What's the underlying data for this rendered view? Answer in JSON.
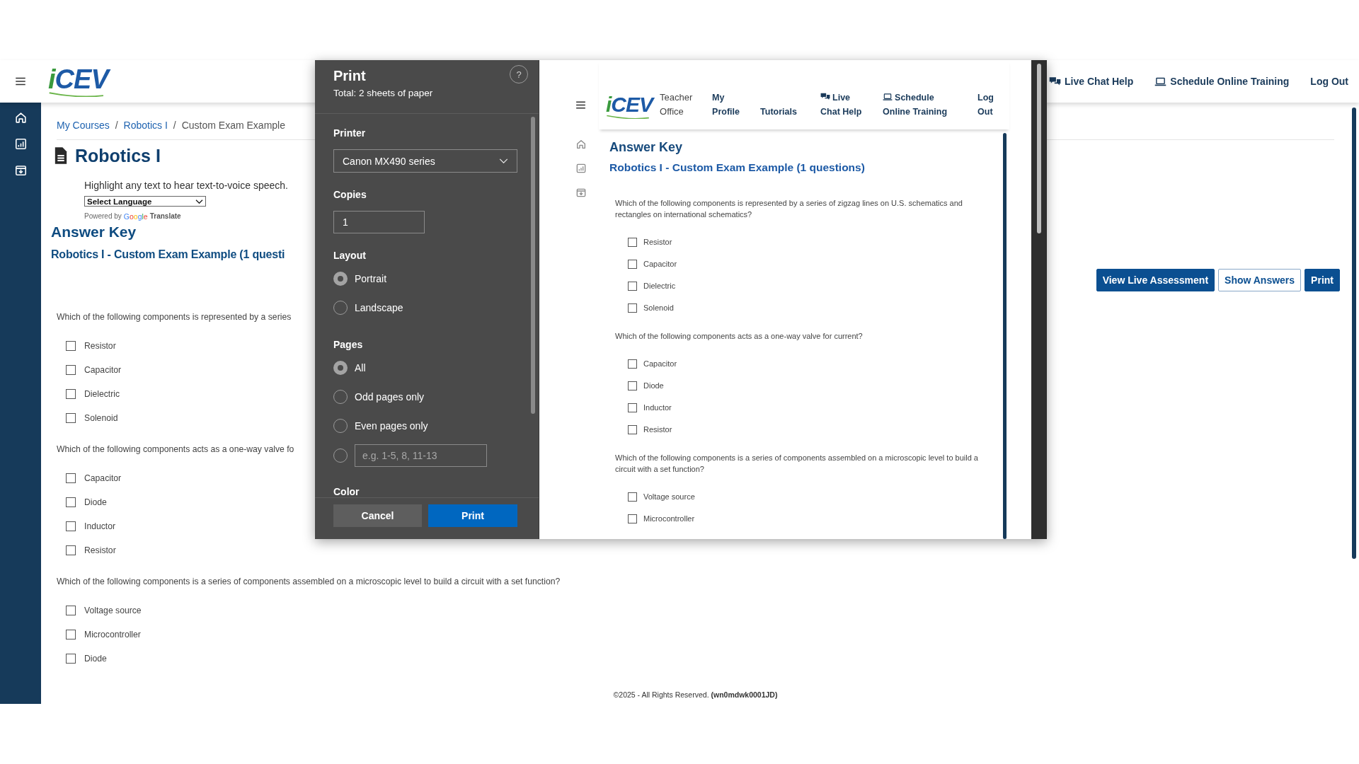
{
  "header": {
    "logo": "iCEV",
    "nav": [
      {
        "kind": "chat",
        "label": "Live Chat Help"
      },
      {
        "kind": "laptop",
        "label": "Schedule Online Training"
      },
      {
        "kind": "plain",
        "label": "Log Out"
      }
    ]
  },
  "breadcrumb": [
    {
      "kind": "link",
      "label": "My Courses"
    },
    {
      "kind": "separator",
      "label": "/"
    },
    {
      "kind": "link",
      "label": "Robotics I"
    },
    {
      "kind": "separator",
      "label": "/"
    },
    {
      "kind": "current",
      "label": "Custom Exam Example"
    }
  ],
  "page_title": "Robotics I",
  "speech_hint": "Highlight any text to hear text-to-voice speech.",
  "language_select": {
    "value": "Select Language"
  },
  "powered_by": {
    "prefix": "Powered by",
    "brand": "Google",
    "suffix": "Translate"
  },
  "answer_key": "Answer Key",
  "exam_title": "Robotics I - Custom Exam Example (1 questi",
  "actions": [
    {
      "label": "View Live Assessment",
      "primary": true
    },
    {
      "label": "Show Answers",
      "primary": false
    },
    {
      "label": "Print",
      "primary": true
    }
  ],
  "questions": [
    {
      "text": "Which of the following components is represented by a series",
      "options": [
        {
          "label": "Resistor",
          "checked": false
        },
        {
          "label": "Capacitor",
          "checked": false
        },
        {
          "label": "Dielectric",
          "checked": false
        },
        {
          "label": "Solenoid",
          "checked": false
        }
      ]
    },
    {
      "text": "Which of the following components acts as a one-way valve fo",
      "options": [
        {
          "label": "Capacitor",
          "checked": false
        },
        {
          "label": "Diode",
          "checked": false
        },
        {
          "label": "Inductor",
          "checked": false
        },
        {
          "label": "Resistor",
          "checked": false
        }
      ]
    },
    {
      "text": "Which of the following components is a series of components assembled on a microscopic level to build a circuit with a set function?",
      "options": [
        {
          "label": "Voltage source",
          "checked": false
        },
        {
          "label": "Microcontroller",
          "checked": false
        },
        {
          "label": "Diode",
          "checked": false
        }
      ]
    }
  ],
  "footer": "©2025 - All Rights Reserved. **(wn0mdwk0001JD)**",
  "print_dialog": {
    "title": "Print",
    "summary": "Total: 2 sheets of paper",
    "help": "?",
    "printer": {
      "label": "Printer",
      "value": "Canon MX490 series"
    },
    "copies": {
      "label": "Copies",
      "value": "1"
    },
    "layout": {
      "label": "Layout",
      "options": [
        {
          "label": "Portrait",
          "selected": true
        },
        {
          "label": "Landscape",
          "selected": false
        }
      ]
    },
    "pages": {
      "label": "Pages",
      "options": [
        {
          "kind": "radio",
          "label": "All",
          "selected": true
        },
        {
          "kind": "radio",
          "label": "Odd pages only",
          "selected": false
        },
        {
          "kind": "radio",
          "label": "Even pages only",
          "selected": false
        },
        {
          "kind": "range",
          "placeholder": "e.g. 1-5, 8, 11-13",
          "selected": false
        }
      ]
    },
    "color": {
      "label": "Color"
    },
    "buttons": [
      {
        "label": "Cancel",
        "primary": false
      },
      {
        "label": "Print",
        "primary": true
      }
    ]
  },
  "preview": {
    "logo": "iCEV",
    "caption": "Teacher Office",
    "nav": [
      {
        "kind": "plain",
        "label": "My Profile"
      },
      {
        "kind": "plain",
        "label": "Tutorials"
      },
      {
        "kind": "chat",
        "label": "Live Chat Help"
      },
      {
        "kind": "laptop",
        "label": "Schedule Online Training"
      },
      {
        "kind": "plain",
        "label": "Log Out"
      }
    ],
    "answer_key": "Answer Key",
    "exam_title": "Robotics I - Custom Exam Example (1 questions)",
    "questions": [
      {
        "text": "Which of the following components is represented by a series of zigzag lines on U.S. schematics and rectangles on international schematics?",
        "options": [
          {
            "label": "Resistor",
            "checked": false
          },
          {
            "label": "Capacitor",
            "checked": false
          },
          {
            "label": "Dielectric",
            "checked": false
          },
          {
            "label": "Solenoid",
            "checked": false
          }
        ]
      },
      {
        "text": "Which of the following components acts as a one-way valve for current?",
        "options": [
          {
            "label": "Capacitor",
            "checked": false
          },
          {
            "label": "Diode",
            "checked": false
          },
          {
            "label": "Inductor",
            "checked": false
          },
          {
            "label": "Resistor",
            "checked": false
          }
        ]
      },
      {
        "text": "Which of the following components is a series of components assembled on a microscopic level to build a circuit with a set function?",
        "options": [
          {
            "label": "Voltage source",
            "checked": false
          },
          {
            "label": "Microcontroller",
            "checked": false
          }
        ]
      }
    ]
  }
}
